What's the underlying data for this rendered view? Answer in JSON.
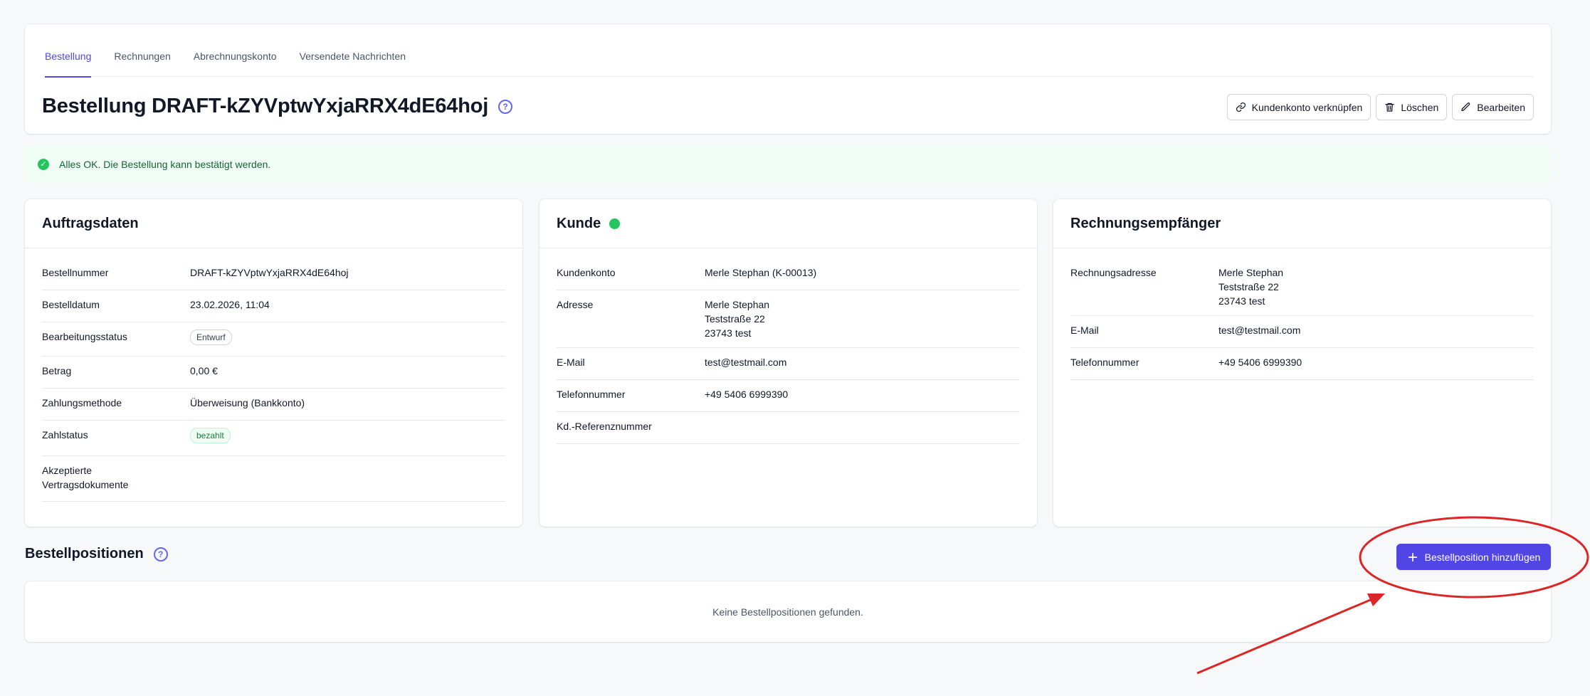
{
  "tabs": [
    {
      "label": "Bestellung",
      "active": true
    },
    {
      "label": "Rechnungen",
      "active": false
    },
    {
      "label": "Abrechnungskonto",
      "active": false
    },
    {
      "label": "Versendete Nachrichten",
      "active": false
    }
  ],
  "header": {
    "title": "Bestellung DRAFT-kZYVptwYxjaRRX4dE64hoj",
    "actions": {
      "link_account": "Kundenkonto verknüpfen",
      "delete": "Löschen",
      "edit": "Bearbeiten"
    }
  },
  "alert": {
    "message": "Alles OK. Die Bestellung kann bestätigt werden."
  },
  "order": {
    "title": "Auftragsdaten",
    "rows": [
      {
        "key": "Bestellnummer",
        "value": "DRAFT-kZYVptwYxjaRRX4dE64hoj"
      },
      {
        "key": "Bestelldatum",
        "value": "23.02.2026, 11:04"
      },
      {
        "key": "Bearbeitungsstatus",
        "value": "Entwurf"
      },
      {
        "key": "Betrag",
        "value": "0,00 €"
      },
      {
        "key": "Zahlungsmethode",
        "value": "Überweisung (Bankkonto)"
      },
      {
        "key": "Zahlstatus",
        "value": "bezahlt"
      },
      {
        "key": "Akzeptierte Vertragsdokumente",
        "value": ""
      }
    ]
  },
  "customer": {
    "title": "Kunde",
    "status_color": "#22c55e",
    "rows": [
      {
        "key": "Kundenkonto",
        "value": "Merle Stephan (K-00013)"
      },
      {
        "key": "Adresse",
        "lines": [
          "Merle Stephan",
          "Teststraße 22",
          "23743 test"
        ]
      },
      {
        "key": "E-Mail",
        "value": "test@testmail.com"
      },
      {
        "key": "Telefonnummer",
        "value": "+49 5406 6999390"
      },
      {
        "key": "Kd.-Referenznummer",
        "value": ""
      }
    ]
  },
  "billing": {
    "title": "Rechnungsempfänger",
    "rows": [
      {
        "key": "Rechnungsadresse",
        "lines": [
          "Merle Stephan",
          "Teststraße 22",
          "23743 test"
        ]
      },
      {
        "key": "E-Mail",
        "value": "test@testmail.com"
      },
      {
        "key": "Telefonnummer",
        "value": "+49 5406 6999390"
      }
    ]
  },
  "positions": {
    "title": "Bestellpositionen",
    "add_label": "Bestellposition hinzufügen",
    "empty_text": "Keine Bestellpositionen gefunden."
  },
  "colors": {
    "accent": "#4f46e5",
    "success": "#22c55e",
    "annotation": "#dc2626"
  },
  "icons": [
    "help-circle-icon",
    "link-icon",
    "trash-icon",
    "pencil-icon",
    "check-circle-icon",
    "plus-icon"
  ]
}
